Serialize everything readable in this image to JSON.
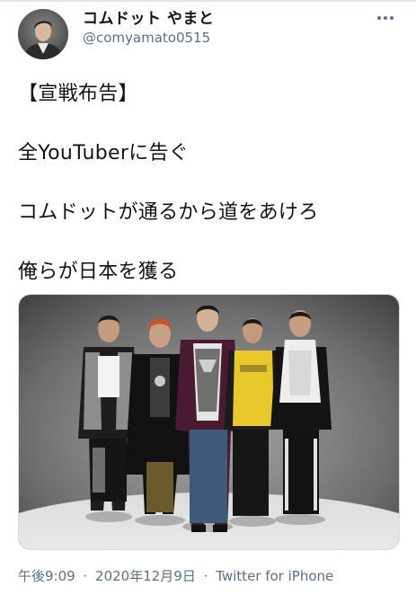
{
  "author": {
    "display_name": "コムドット やまと",
    "handle": "@comyamato0515"
  },
  "tweet": {
    "lines": [
      "【宣戦布告】",
      "全YouTuberに告ぐ",
      "コムドットが通るから道をあけろ",
      "俺らが日本を獲る"
    ]
  },
  "meta": {
    "time": "午後9:09",
    "separator": "·",
    "date": "2020年12月9日",
    "source": "Twitter for iPhone"
  },
  "colors": {
    "text": "#141414",
    "secondary": "#5b7083",
    "border": "#d6dde2"
  },
  "icons": {
    "more": "more-horizontal-icon"
  }
}
